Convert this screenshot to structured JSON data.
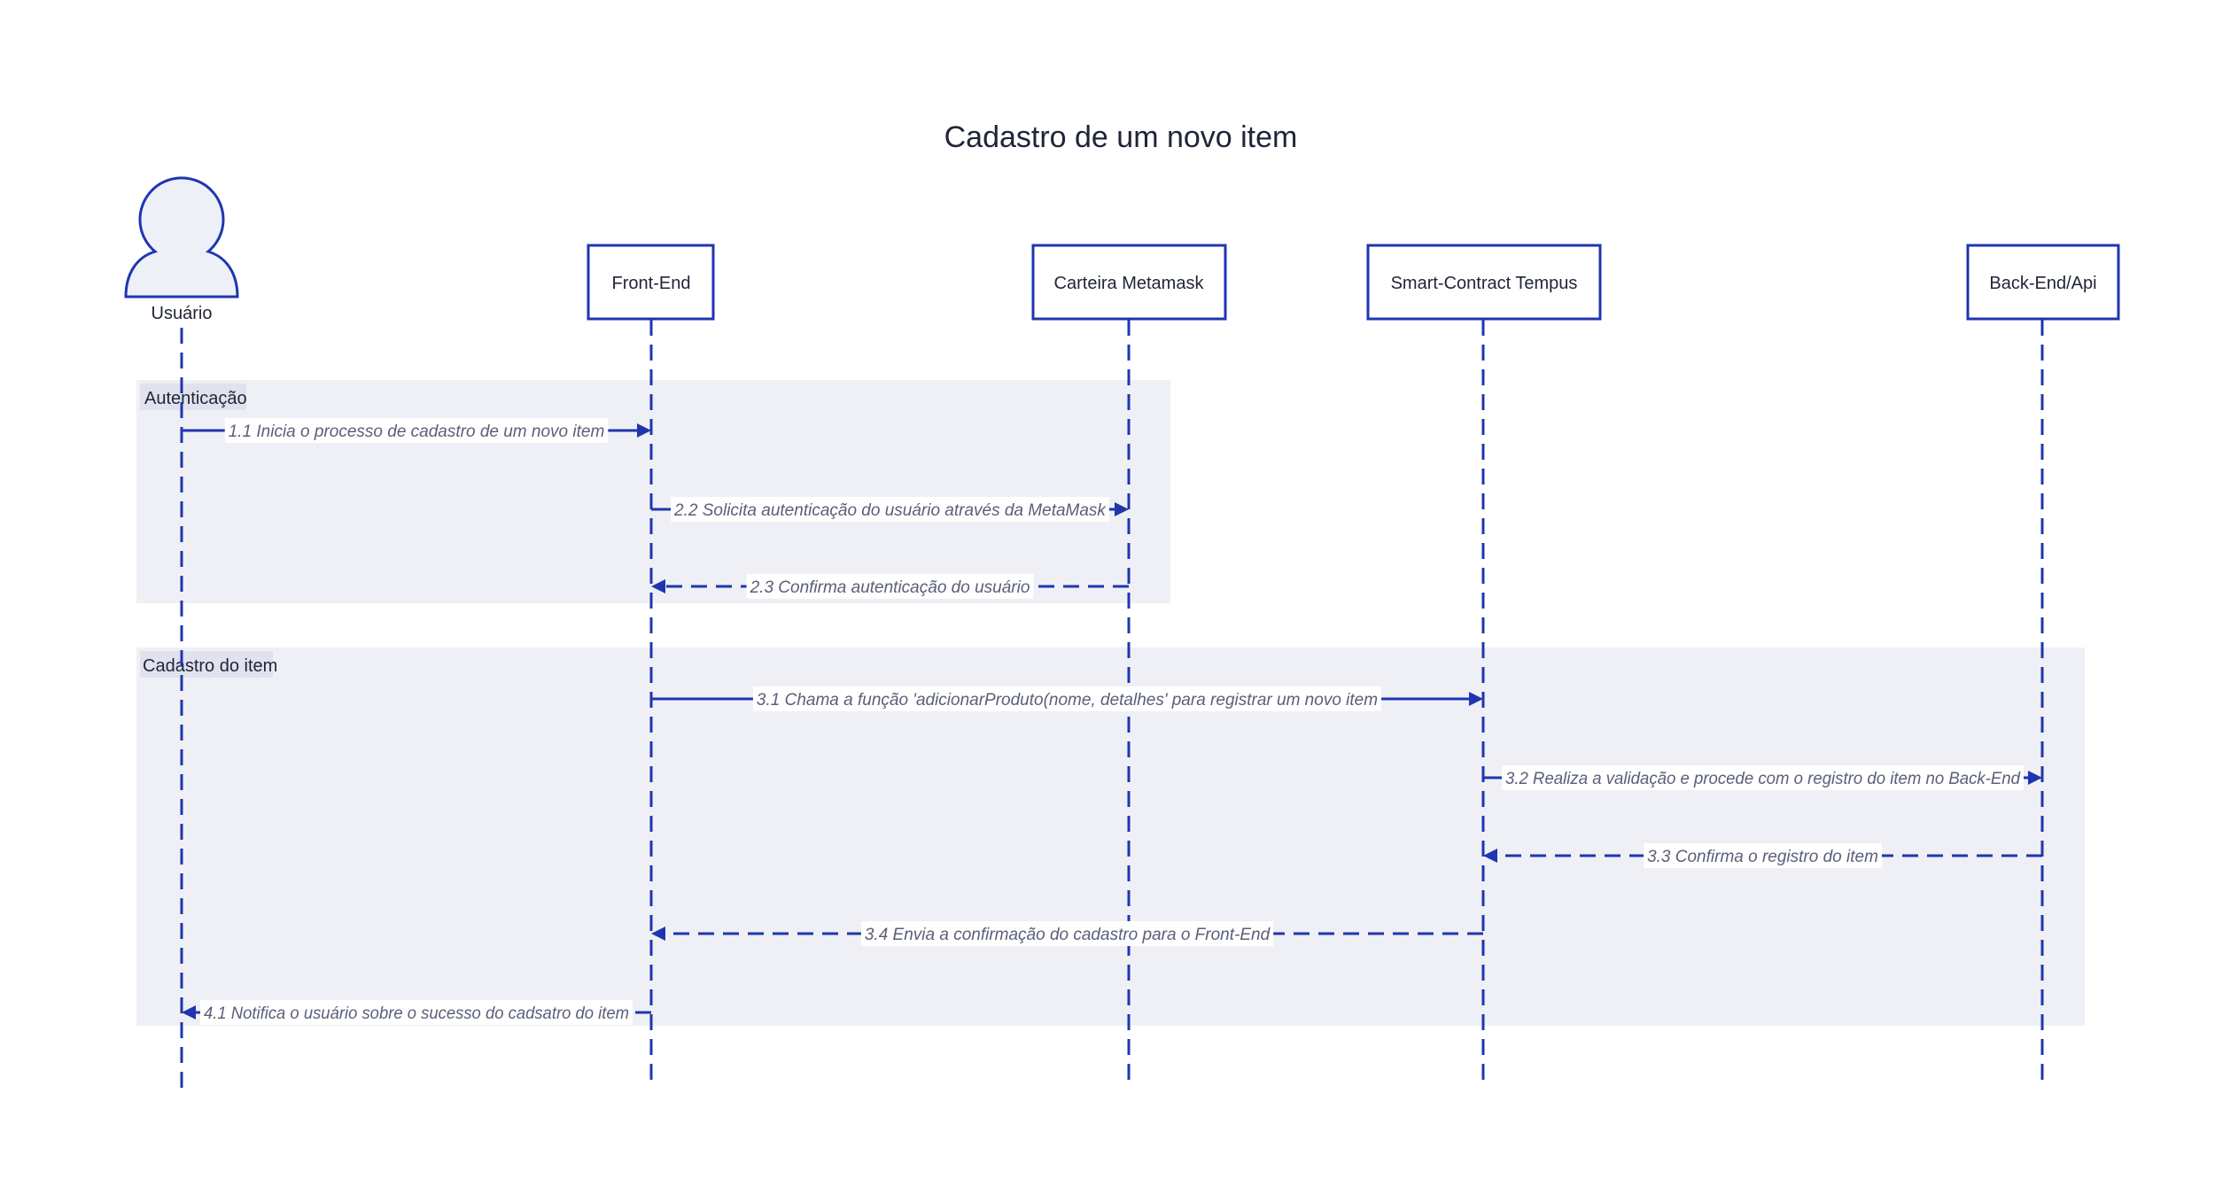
{
  "title": "Cadastro de um novo item",
  "colors": {
    "line": "#1f35b0",
    "group_background": "#eef0f5",
    "label_text": "#5a5f78"
  },
  "participants": [
    {
      "id": "user",
      "label": "Usuário",
      "kind": "person-icon"
    },
    {
      "id": "frontend",
      "label": "Front-End",
      "kind": "box"
    },
    {
      "id": "metamask",
      "label": "Carteira Metamask",
      "kind": "box"
    },
    {
      "id": "contract",
      "label": "Smart-Contract Tempus",
      "kind": "box"
    },
    {
      "id": "backend",
      "label": "Back-End/Api",
      "kind": "box"
    }
  ],
  "groups": [
    {
      "label": "Autenticação"
    },
    {
      "label": "Cadastro do item"
    }
  ],
  "messages": [
    {
      "from": "user",
      "to": "frontend",
      "label": "1.1 Inicia o processo de cadastro de um novo item",
      "style": "solid"
    },
    {
      "from": "frontend",
      "to": "metamask",
      "label": "2.2 Solicita autenticação do usuário através da MetaMask",
      "style": "solid"
    },
    {
      "from": "metamask",
      "to": "frontend",
      "label": "2.3 Confirma autenticação do usuário",
      "style": "dashed"
    },
    {
      "from": "frontend",
      "to": "contract",
      "label": "3.1 Chama a função 'adicionarProduto(nome, detalhes' para registrar um novo item",
      "style": "solid"
    },
    {
      "from": "contract",
      "to": "backend",
      "label": "3.2 Realiza a validação e procede com o registro do item no Back-End",
      "style": "solid"
    },
    {
      "from": "backend",
      "to": "contract",
      "label": "3.3 Confirma o registro do item",
      "style": "dashed"
    },
    {
      "from": "contract",
      "to": "frontend",
      "label": "3.4 Envia a confirmação do cadastro para o Front-End",
      "style": "dashed"
    },
    {
      "from": "frontend",
      "to": "user",
      "label": "4.1 Notifica o usuário sobre o sucesso do cadsatro do item",
      "style": "dashed"
    }
  ]
}
